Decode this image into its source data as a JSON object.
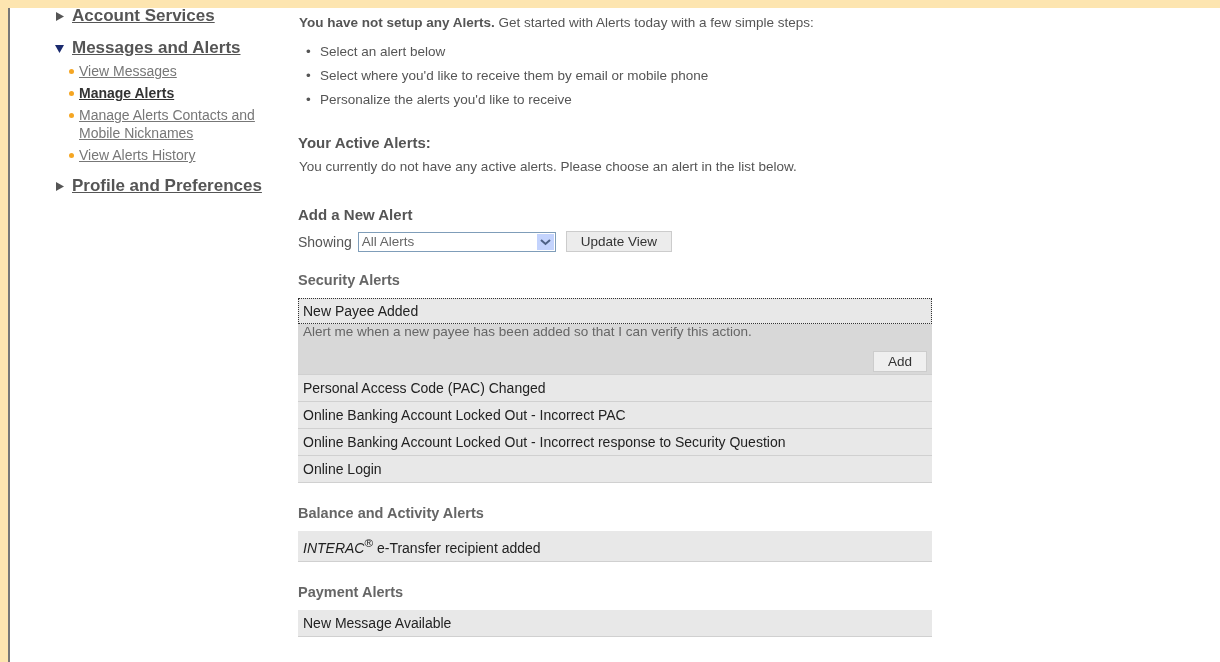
{
  "sidebar": {
    "sections": [
      {
        "label": "Account Services",
        "expanded": false
      },
      {
        "label": "Messages and Alerts",
        "expanded": true,
        "items": [
          {
            "label": "View Messages",
            "selected": false
          },
          {
            "label": "Manage Alerts",
            "selected": true
          },
          {
            "label": "Manage Alerts Contacts and Mobile Nicknames",
            "selected": false
          },
          {
            "label": "View Alerts History",
            "selected": false
          }
        ]
      },
      {
        "label": "Profile and Preferences",
        "expanded": false
      }
    ]
  },
  "intro": "**You have not setup any Alerts.** Get started with Alerts today with a few simple steps:",
  "step_marker": "•",
  "steps": [
    "Select an alert below",
    "Select where you'd like to receive them by email or mobile phone",
    "Personalize the alerts you'd like to receive"
  ],
  "active_alerts": {
    "heading": "Your Active Alerts:",
    "message": "You currently do not have any active alerts. Please choose an alert in the list below."
  },
  "add_alert": {
    "heading": "Add a New Alert",
    "filter_label": "Showing",
    "filter_value": "All Alerts",
    "update_button": "Update View"
  },
  "groups": [
    {
      "title": "Security Alerts",
      "alerts": [
        {
          "name": "New Payee Added",
          "expanded": true,
          "description": "Alert me when a new payee has been added so that I can verify this action.",
          "button": "Add"
        },
        {
          "name": "Personal Access Code (PAC) Changed",
          "expanded": false
        },
        {
          "name": "Online Banking Account Locked Out - Incorrect PAC",
          "expanded": false
        },
        {
          "name": "Online Banking Account Locked Out - Incorrect response to Security Question",
          "expanded": false
        },
        {
          "name": "Online Login",
          "expanded": false
        }
      ]
    },
    {
      "title": "Balance and Activity Alerts",
      "alerts": [
        {
          "name": "*INTERAC*$^{®}$ e-Transfer recipient added",
          "expanded": false
        }
      ]
    },
    {
      "title": "Payment Alerts",
      "alerts": [
        {
          "name": "New Message Available",
          "expanded": false
        }
      ]
    }
  ]
}
